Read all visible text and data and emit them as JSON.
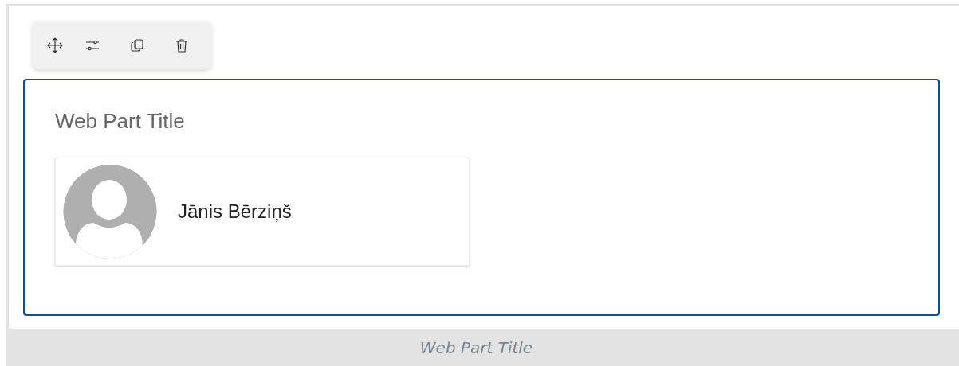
{
  "toolbar": {
    "buttons": [
      {
        "kind": "move"
      },
      {
        "kind": "edit"
      },
      {
        "kind": "duplicate"
      },
      {
        "kind": "delete"
      }
    ]
  },
  "web_part": {
    "title": "Web Part Title",
    "people": [
      {
        "name": "Jānis Bērziņš"
      }
    ]
  },
  "footer": {
    "caption": "Web Part Title"
  }
}
